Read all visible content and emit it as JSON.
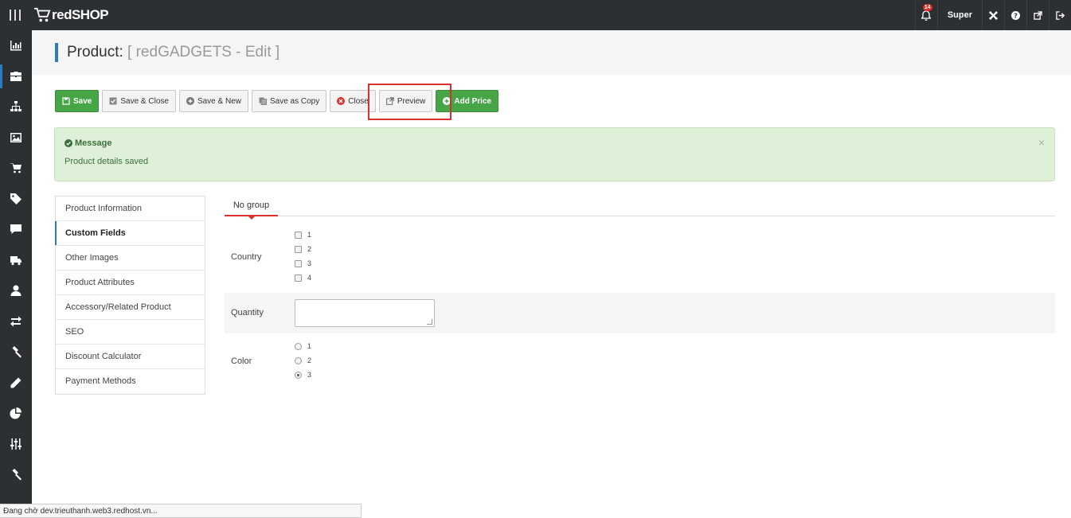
{
  "app": {
    "logo_text": "redSHOP"
  },
  "topbar": {
    "notification_count": "14",
    "user_label": "Super",
    "icons": [
      "bell-icon",
      "joomla-icon",
      "help-icon",
      "external-link-icon",
      "logout-icon"
    ]
  },
  "sidebar": {
    "active_index": 1,
    "icons": [
      "dashboard-icon",
      "briefcase-icon",
      "sitemap-icon",
      "image-icon",
      "cart-icon",
      "tag-icon",
      "comment-icon",
      "truck-icon",
      "user-icon",
      "exchange-icon",
      "gavel-icon",
      "pencil-icon",
      "pie-chart-icon",
      "sliders-icon",
      "hammer-icon"
    ]
  },
  "page": {
    "title": "Product:",
    "subtitle": "[ redGADGETS - Edit ]"
  },
  "toolbar": {
    "save": "Save",
    "save_close": "Save & Close",
    "save_new": "Save & New",
    "save_copy": "Save as Copy",
    "close": "Close",
    "preview": "Preview",
    "add_price": "Add Price"
  },
  "message": {
    "heading": "Message",
    "body": "Product details saved",
    "close": "×"
  },
  "tabs": [
    "Product Information",
    "Custom Fields",
    "Other Images",
    "Product Attributes",
    "Accessory/Related Product",
    "SEO",
    "Discount Calculator",
    "Payment Methods"
  ],
  "active_tab": "Custom Fields",
  "group_tab": "No group",
  "fields": {
    "country": {
      "label": "Country",
      "options": [
        "1",
        "2",
        "3",
        "4"
      ]
    },
    "quantity": {
      "label": "Quantity",
      "value": ""
    },
    "color": {
      "label": "Color",
      "options": [
        "1",
        "2",
        "3"
      ],
      "selected": "3"
    }
  },
  "statusbar": {
    "text": "Đang chờ dev.trieuthanh.web3.redhost.vn..."
  },
  "colors": {
    "topbar": "#2d3033",
    "accent": "#2b7bc0",
    "success": "#46a546",
    "alert_bg": "#dff0d8",
    "highlight": "#d9302c"
  }
}
